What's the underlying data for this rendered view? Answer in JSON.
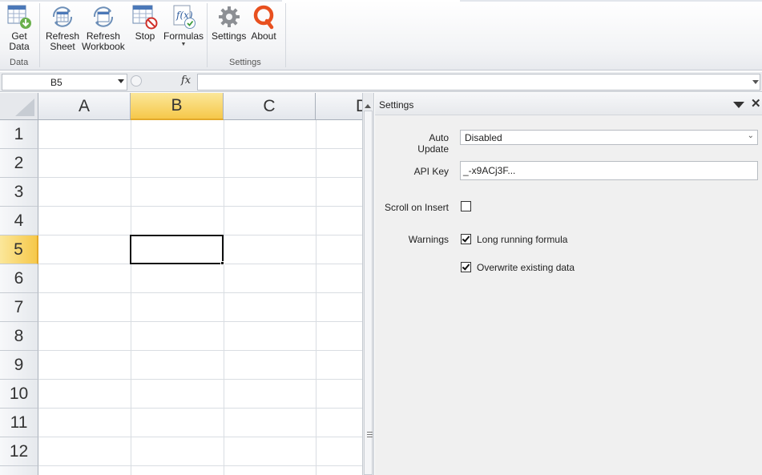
{
  "ribbon": {
    "buttons": {
      "get_data": "Get\nData",
      "get_data_l1": "Get",
      "get_data_l2": "Data",
      "refresh_sheet_l1": "Refresh",
      "refresh_sheet_l2": "Sheet",
      "refresh_workbook_l1": "Refresh",
      "refresh_workbook_l2": "Workbook",
      "stop": "Stop",
      "formulas": "Formulas",
      "settings": "Settings",
      "about": "About"
    },
    "groups": {
      "data": "Data",
      "settings": "Settings"
    },
    "icons": [
      "table-download-icon",
      "refresh-sheet-icon",
      "refresh-workbook-icon",
      "stop-icon",
      "function-icon",
      "gear-icon",
      "quandl-logo-icon"
    ],
    "accent": "#e8501f"
  },
  "formula_bar": {
    "name_box": "B5",
    "fx": "fx",
    "formula": ""
  },
  "grid": {
    "columns": [
      "A",
      "B",
      "C",
      "D"
    ],
    "rows": [
      "1",
      "2",
      "3",
      "4",
      "5",
      "6",
      "7",
      "8",
      "9",
      "10",
      "11",
      "12"
    ],
    "active_cell": "B5",
    "selection_color": "#f6c84a"
  },
  "settings_pane": {
    "title": "Settings",
    "auto_update": {
      "label": "Auto Update",
      "value": "Disabled"
    },
    "api_key": {
      "label": "API Key",
      "value": "_-x9ACj3F..."
    },
    "scroll_on_insert": {
      "label": "Scroll on Insert",
      "checked": false
    },
    "warnings": {
      "label": "Warnings",
      "options": [
        {
          "label": "Long running formula",
          "checked": true
        },
        {
          "label": "Overwrite existing data",
          "checked": true
        }
      ]
    }
  }
}
